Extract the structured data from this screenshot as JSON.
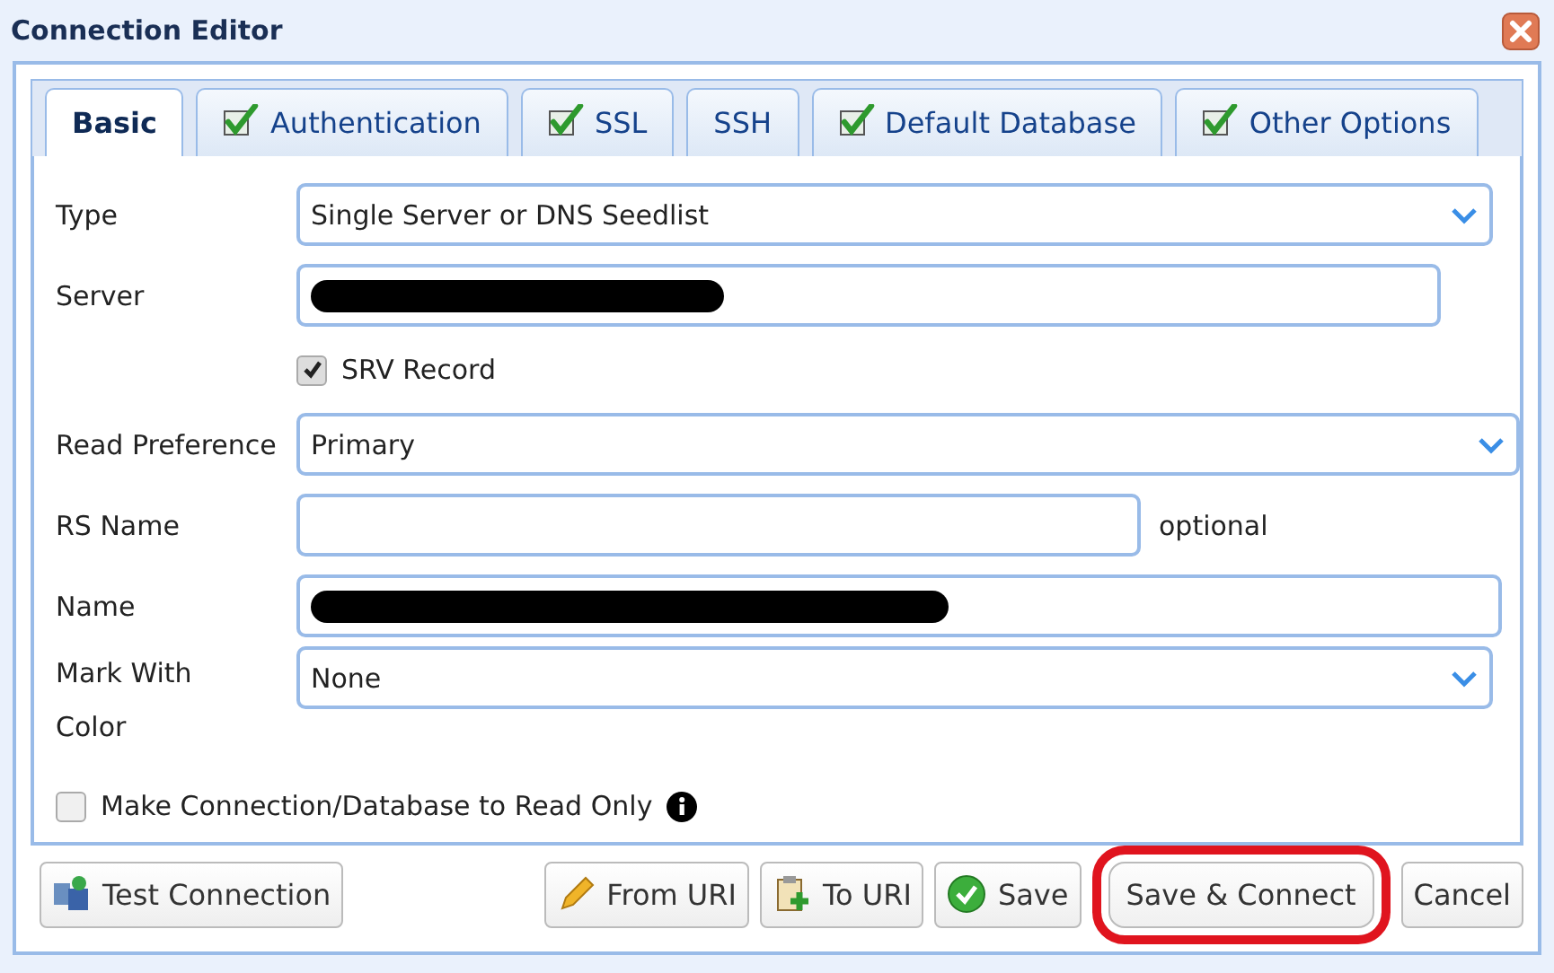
{
  "window": {
    "title": "Connection Editor"
  },
  "tabs": [
    {
      "label": "Basic",
      "selected": true,
      "checked": false
    },
    {
      "label": "Authentication",
      "selected": false,
      "checked": true
    },
    {
      "label": "SSL",
      "selected": false,
      "checked": true
    },
    {
      "label": "SSH",
      "selected": false,
      "checked": false
    },
    {
      "label": "Default Database",
      "selected": false,
      "checked": true
    },
    {
      "label": "Other Options",
      "selected": false,
      "checked": true
    }
  ],
  "fields": [
    {
      "kind": "select",
      "label": "Type",
      "value": "Single Server or DNS Seedlist"
    },
    {
      "kind": "input",
      "label": "Server",
      "redacted": true
    },
    {
      "kind": "checkbox",
      "label": "SRV Record",
      "checked": true
    },
    {
      "kind": "select",
      "label": "Read Preference",
      "value": "Primary"
    },
    {
      "kind": "input",
      "label": "RS Name",
      "hint": "optional"
    },
    {
      "kind": "input",
      "label": "Name",
      "redacted": true
    },
    {
      "kind": "select",
      "label": "Mark With Color",
      "value": "None"
    },
    {
      "kind": "checkbox",
      "label": "Make Connection/Database to Read Only",
      "checked": false,
      "info": true
    }
  ],
  "buttons": [
    {
      "label": "Test Connection",
      "highlighted": false
    },
    {
      "label": "From URI",
      "highlighted": false
    },
    {
      "label": "To URI",
      "highlighted": false
    },
    {
      "label": "Save",
      "highlighted": false
    },
    {
      "label": "Save & Connect",
      "highlighted": true
    },
    {
      "label": "Cancel",
      "highlighted": false
    }
  ]
}
